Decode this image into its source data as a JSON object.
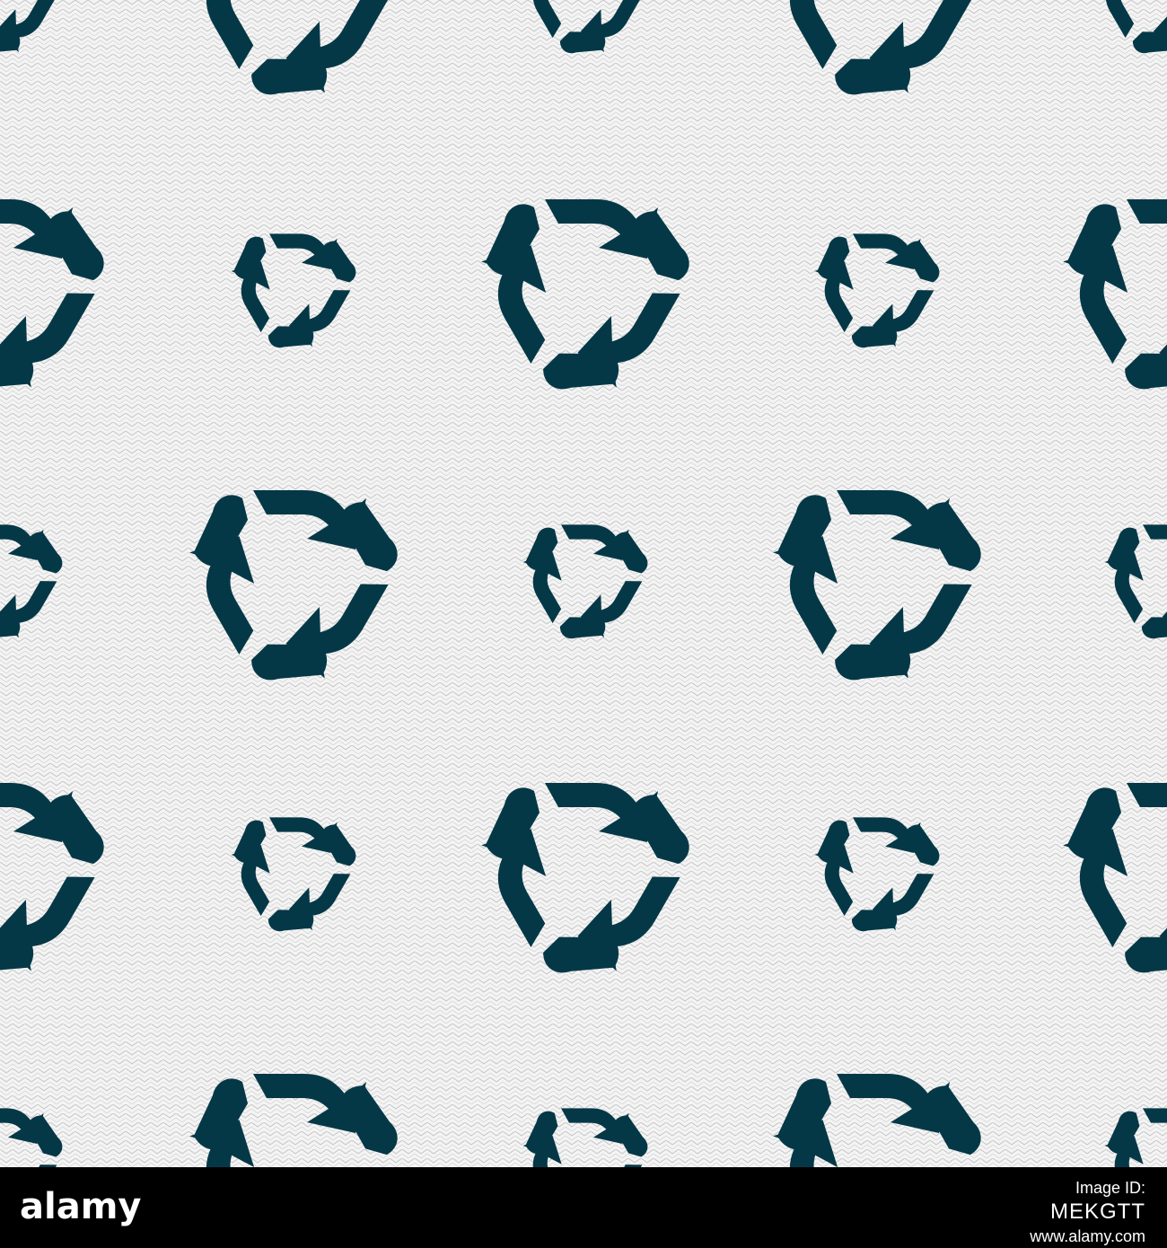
{
  "colors": {
    "background": "#f4f4f4",
    "zigzag": "#c9c9c9",
    "icon": "#053847",
    "bar": "#000000",
    "text": "#ffffff"
  },
  "pattern": {
    "icon": "recycle-icon"
  },
  "watermark": {
    "logo_text": "alamy",
    "id_label": "Image ID:",
    "id_code": "MEKGTT",
    "site": "www.alamy.com"
  }
}
